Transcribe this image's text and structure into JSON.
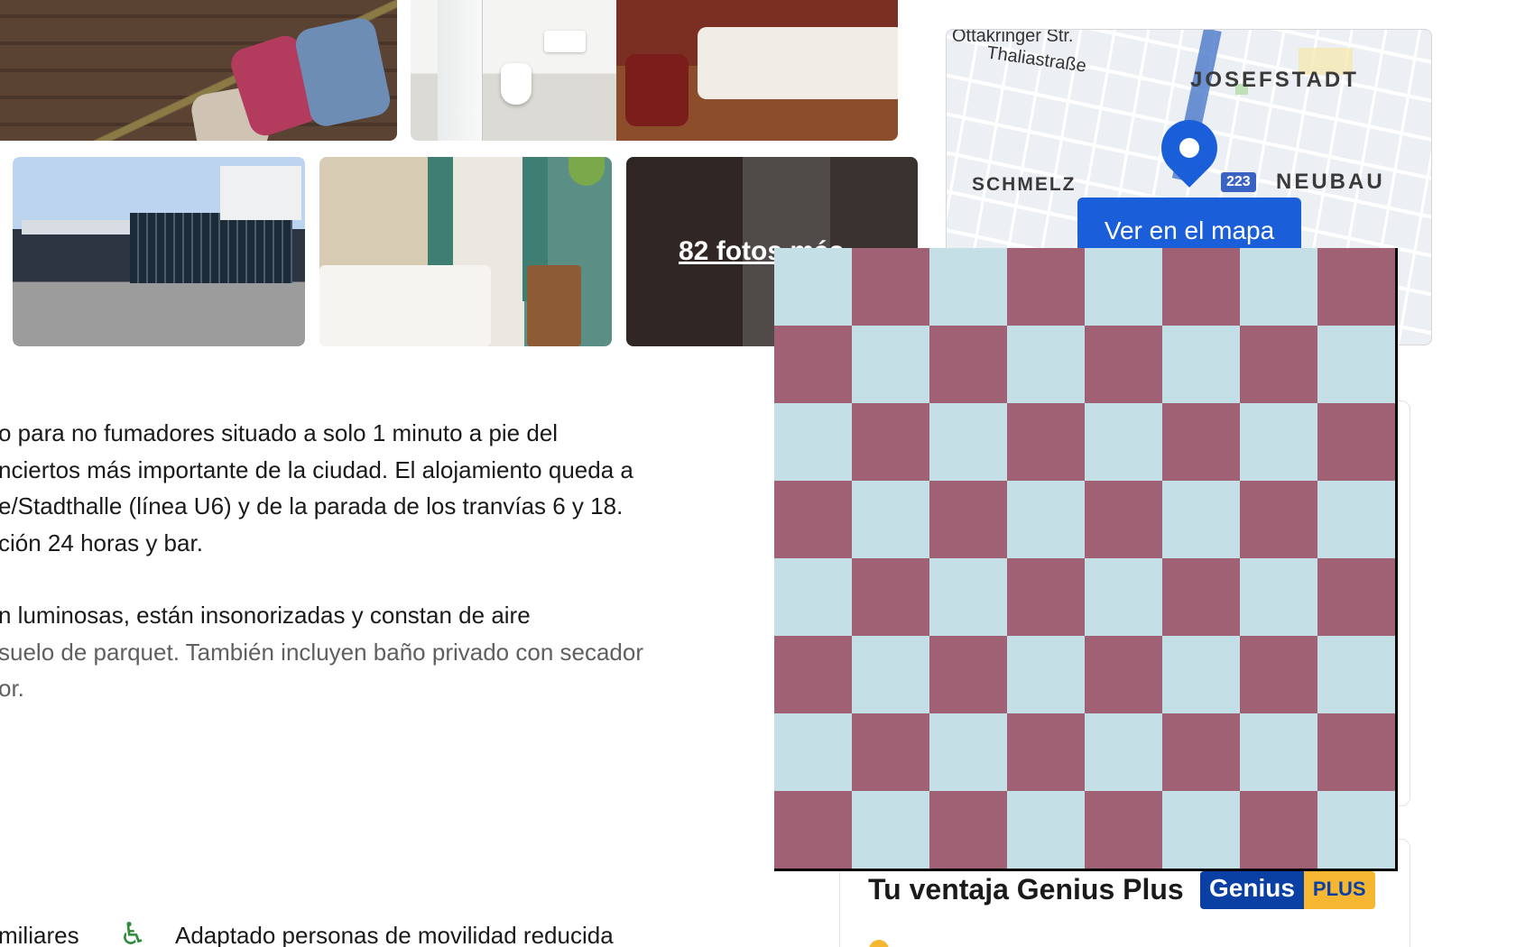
{
  "gallery": {
    "more_photos_label": "82 fotos más"
  },
  "map": {
    "streets": [
      "Ottakringer Str.",
      "Thaliastraße"
    ],
    "districts": [
      "JOSEFSTADT",
      "SCHMELZ",
      "NEUBAU"
    ],
    "road_number": "223",
    "button_label": "Ver en el mapa"
  },
  "description": {
    "lines_p1": [
      "o para no fumadores situado a solo 1 minuto a pie del",
      "nciertos más importante de la ciudad. El alojamiento queda a",
      "e/Stadthalle (línea U6) y de la parada de los tranvías 6 y 18.",
      "ción 24 horas y bar."
    ],
    "lines_p2": [
      "n luminosas, están insonorizadas y constan de aire",
      "suelo de parquet. También incluyen baño privado con secador",
      "or."
    ]
  },
  "facilities": {
    "item_left": "miliares",
    "item_accessible": "Adaptado personas de movilidad reducida",
    "accessible_icon": "wheelchair-icon"
  },
  "genius": {
    "title": "Tu ventaja Genius Plus",
    "logo_text": "Genius",
    "logo_plus": "PLUS"
  },
  "colors": {
    "checker_dark": "#a06175",
    "checker_light": "#c5dfe6",
    "primary_blue": "#1a5fd9",
    "genius_blue": "#0a3fa3",
    "genius_yellow": "#f5b731"
  }
}
